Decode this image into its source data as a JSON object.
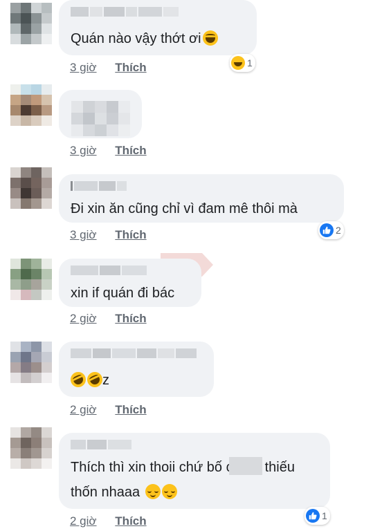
{
  "comments": [
    {
      "text": "Quán nào vậy thớt ơi",
      "text_emoji": "laughing-tears",
      "time": "3 giờ",
      "like_label": "Thích",
      "reaction": {
        "type": "haha",
        "count": "1"
      }
    },
    {
      "text": "",
      "time": "3 giờ",
      "like_label": "Thích"
    },
    {
      "text": "Đi xin ăn cũng chỉ vì đam mê thôi mà",
      "time": "3 giờ",
      "like_label": "Thích",
      "reaction": {
        "type": "like",
        "count": "2"
      }
    },
    {
      "text": "xin if quán đi bác",
      "time": "2 giờ",
      "like_label": "Thích"
    },
    {
      "text": "z",
      "text_emoji": "rolling-on-floor-laughing x2",
      "time": "2 giờ",
      "like_label": "Thích"
    },
    {
      "text_line1_a": "Thích thì xin thoii chứ bố c",
      "text_line1_b": "thiếu",
      "text_line2": "thốn nhaaa",
      "text_emoji": "relieved-face x2",
      "time": "2 giờ",
      "like_label": "Thích",
      "reaction": {
        "type": "like",
        "count": "1"
      }
    }
  ],
  "colors": {
    "bubble": "#f0f2f5",
    "meta_text": "#606770",
    "like_blue": "#1877f2",
    "emoji_yellow": "#fcc21b"
  }
}
